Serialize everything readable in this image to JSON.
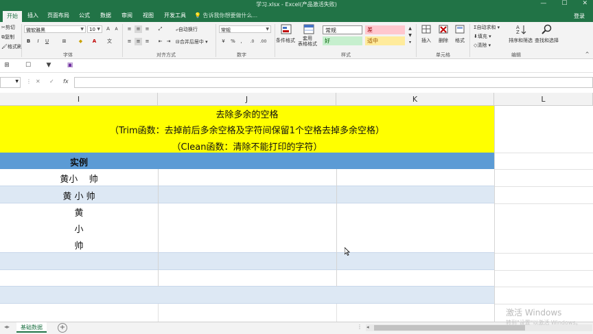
{
  "window": {
    "title": "学习.xlsx - Excel(产品激活失败)",
    "controls": [
      "—",
      "☐",
      "✕"
    ]
  },
  "ribbon_tabs": [
    "开始",
    "插入",
    "页面布局",
    "公式",
    "数据",
    "审阅",
    "视图",
    "开发工具"
  ],
  "tell_me": "告诉我你想要做什么...",
  "login": "登录",
  "ribbon": {
    "clipboard": {
      "cut": "剪切",
      "copy": "复制",
      "format_painter": "格式刷"
    },
    "font": {
      "name": "微软雅黑",
      "size": "10",
      "label": "字体",
      "bold": "B",
      "italic": "I",
      "underline": "U"
    },
    "alignment": {
      "wrap": "自动换行",
      "merge": "合并后居中",
      "label": "对齐方式"
    },
    "number": {
      "format": "常规",
      "label": "数字"
    },
    "styles": {
      "conditional": "条件格式",
      "table_format": "套用\n表格格式",
      "normal": "常规",
      "bad": "差",
      "good": "好",
      "neutral": "适中",
      "label": "样式"
    },
    "cells": {
      "insert": "插入",
      "delete": "删除",
      "format": "格式",
      "label": "单元格"
    },
    "editing": {
      "autosum": "自动求和",
      "fill": "填充",
      "clear": "清除",
      "sort_filter": "排序和筛选",
      "find_select": "查找和选择",
      "label": "编辑"
    }
  },
  "formula_bar": {
    "fx": "fx",
    "value": ""
  },
  "columns": [
    "I",
    "J",
    "K",
    "L"
  ],
  "cells": {
    "title_line1": "去除多余的空格",
    "title_line2": "（Trim函数：去掉前后多余空格及字符间保留1个空格去掉多余空格）",
    "title_line3": "（Clean函数：清除不能打印的字符）",
    "example_header": "实例",
    "row1": "黄小    帅",
    "row2": "黄 小 帅",
    "row3a": "黄",
    "row3b": "小",
    "row3c": "帅"
  },
  "sheet_tab": "基础数据",
  "watermark": {
    "line1": "激活 Windows",
    "line2": "转到\"设置\"以激活 Windows。"
  },
  "colors": {
    "excel_green": "#217346",
    "title_yellow": "#ffff00",
    "header_blue": "#5b9bd5",
    "band_light_blue": "#dde8f4"
  }
}
